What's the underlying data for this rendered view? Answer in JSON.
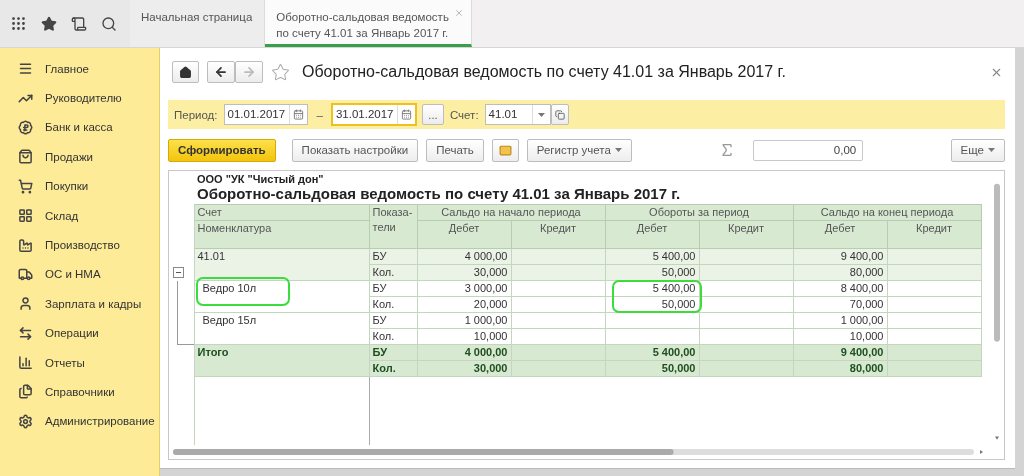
{
  "tabs": [
    {
      "label": "Начальная страница",
      "selected": false,
      "closable": false
    },
    {
      "label": "Оборотно-сальдовая ведомость\nпо счету 41.01 за Январь 2017 г.",
      "selected": true,
      "closable": true
    }
  ],
  "sidebar": {
    "items": [
      {
        "label": "Главное"
      },
      {
        "label": "Руководителю"
      },
      {
        "label": "Банк и касса"
      },
      {
        "label": "Продажи"
      },
      {
        "label": "Покупки"
      },
      {
        "label": "Склад"
      },
      {
        "label": "Производство"
      },
      {
        "label": "ОС и НМА"
      },
      {
        "label": "Зарплата и кадры"
      },
      {
        "label": "Операции"
      },
      {
        "label": "Отчеты"
      },
      {
        "label": "Справочники"
      },
      {
        "label": "Администрирование"
      }
    ]
  },
  "form": {
    "title": "Оборотно-сальдовая ведомость по счету 41.01 за Январь 2017 г.",
    "back": {
      "disabled": false
    },
    "forward": {
      "disabled": true
    },
    "filters": {
      "period_label": "Период:",
      "period_start": {
        "value": "01.01.2017",
        "focused": false
      },
      "separator": "–",
      "period_end": {
        "value": "31.01.2017",
        "focused": true
      },
      "more_label": "...",
      "account_label": "Счет:",
      "account": {
        "value": "41.01"
      }
    },
    "toolbar": [
      {
        "kind": "primary",
        "label": "Сформировать"
      },
      {
        "kind": "default",
        "label": "Показать настройки"
      },
      {
        "kind": "default",
        "label": "Печать"
      },
      {
        "kind": "mail"
      },
      {
        "kind": "dropdown",
        "label": "Регистр учета"
      }
    ],
    "sum_field": {
      "value": "0,00"
    },
    "more_button": {
      "label": "Еще"
    }
  },
  "report": {
    "organization": "ООО \"УК \"Чистый дон\"",
    "title": "Оборотно-сальдовая ведомость по счету 41.01 за Январь 2017 г.",
    "header": {
      "account_label": "Счет",
      "item_label": "Номенклатура",
      "indicators_label": "Показа-\nтели",
      "groups": [
        {
          "title": "Сальдо на начало периода",
          "debit": "Дебет",
          "credit": "Кредит"
        },
        {
          "title": "Обороты за период",
          "debit": "Дебет",
          "credit": "Кредит"
        },
        {
          "title": "Сальдо на конец периода",
          "debit": "Дебет",
          "credit": "Кредит"
        }
      ]
    },
    "rows": [
      {
        "kind": "account",
        "name": "41.01",
        "expanded": true,
        "highlight_name": false,
        "highlight_turnover": false,
        "lines": [
          {
            "indicator": "БУ",
            "opening_debit": "4 000,00",
            "turnover_debit": "5 400,00",
            "closing_debit": "9 400,00"
          },
          {
            "indicator": "Кол.",
            "opening_debit": "30,000",
            "turnover_debit": "50,000",
            "closing_debit": "80,000"
          }
        ],
        "children": [
          {
            "kind": "item",
            "name": "Ведро 10л",
            "highlight_name": true,
            "highlight_turnover": true,
            "lines": [
              {
                "indicator": "БУ",
                "opening_debit": "3 000,00",
                "turnover_debit": "5 400,00",
                "closing_debit": "8 400,00"
              },
              {
                "indicator": "Кол.",
                "opening_debit": "20,000",
                "turnover_debit": "50,000",
                "closing_debit": "70,000"
              }
            ]
          },
          {
            "kind": "item",
            "name": "Ведро 15л",
            "highlight_name": false,
            "highlight_turnover": false,
            "lines": [
              {
                "indicator": "БУ",
                "opening_debit": "1 000,00",
                "closing_debit": "1 000,00"
              },
              {
                "indicator": "Кол.",
                "opening_debit": "10,000",
                "closing_debit": "10,000"
              }
            ]
          }
        ]
      },
      {
        "kind": "total",
        "name": "Итого",
        "highlight_name": false,
        "highlight_turnover": false,
        "lines": [
          {
            "indicator": "БУ",
            "opening_debit": "4 000,00",
            "turnover_debit": "5 400,00",
            "closing_debit": "9 400,00"
          },
          {
            "indicator": "Кол.",
            "opening_debit": "30,000",
            "turnover_debit": "50,000",
            "closing_debit": "80,000"
          }
        ]
      }
    ]
  }
}
